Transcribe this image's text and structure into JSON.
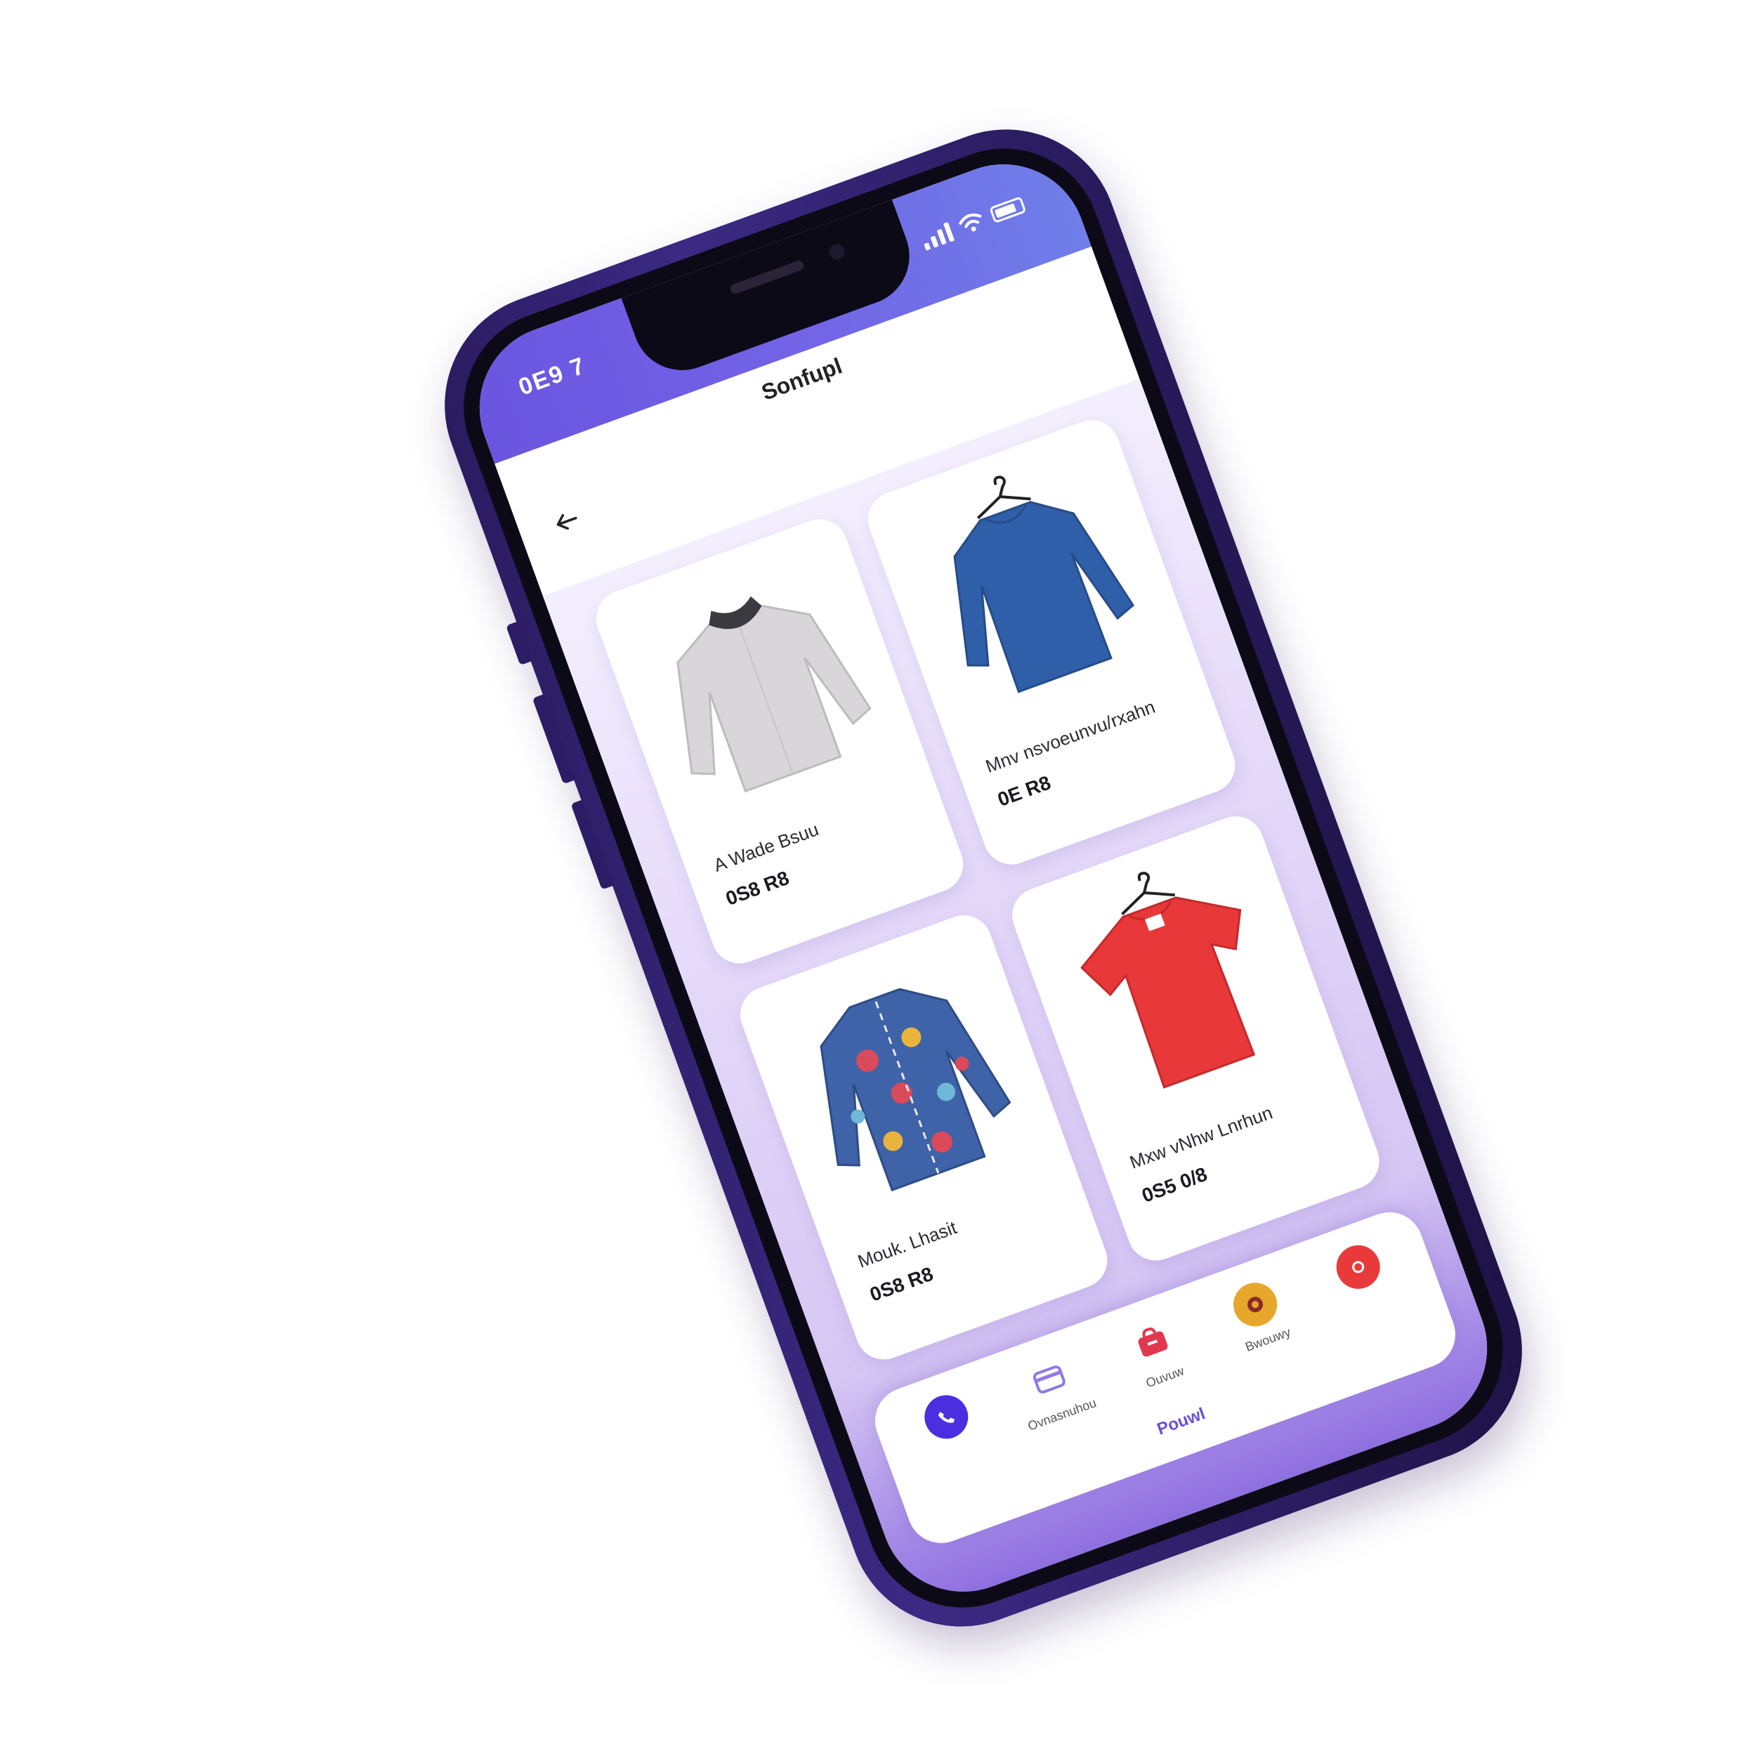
{
  "status_bar": {
    "time": "0E9 7",
    "icons": [
      "signal-icon",
      "wifi-icon",
      "battery-icon"
    ]
  },
  "header": {
    "title": "Sonfupl",
    "back_icon": "back-arrow-icon"
  },
  "products": [
    {
      "name": "A Wade Bsuu",
      "price": "0S8 R8",
      "image": "grey-sweater"
    },
    {
      "name": "Mnv nsvoeunvu/rxahn",
      "price": "0E R8",
      "image": "blue-sweater"
    },
    {
      "name": "Mouk. Lhasit",
      "price": "0S8 R8",
      "image": "floral-jacket"
    },
    {
      "name": "Mxw vNhw Lnrhun",
      "price": "0S5 0/8",
      "image": "red-tshirt"
    }
  ],
  "bottom_nav": {
    "items": [
      {
        "label": "",
        "icon": "phone-icon",
        "color": "#4b2ee0"
      },
      {
        "label": "Ovnasnuhou",
        "icon": "card-icon",
        "color": "#8f7ae6"
      },
      {
        "label": "Ouvuw",
        "icon": "bag-icon",
        "color": "#e2384f"
      },
      {
        "label": "Bwouwy",
        "icon": "coin-icon",
        "color": "#e7a72a"
      },
      {
        "label": "",
        "icon": "record-icon",
        "color": "#e83a3a"
      }
    ],
    "home_label": "Pouwl"
  },
  "colors": {
    "accent": "#6b55e0",
    "frame": "#2c1c66",
    "background_gradient_end": "#8f6fe0"
  }
}
